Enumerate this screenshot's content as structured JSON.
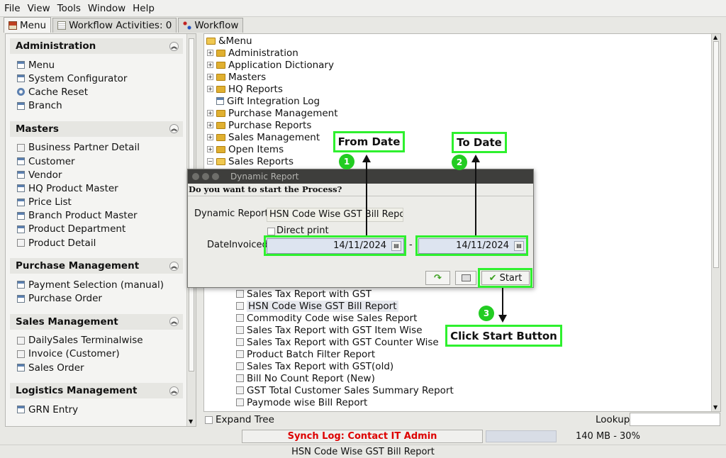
{
  "menubar": {
    "items": [
      "File",
      "View",
      "Tools",
      "Window",
      "Help"
    ]
  },
  "tabs": [
    {
      "label": "Menu"
    },
    {
      "label": "Workflow Activities: 0"
    },
    {
      "label": "Workflow"
    }
  ],
  "sidebar": {
    "groups": [
      {
        "title": "Administration",
        "items": [
          "Menu",
          "System Configurator",
          "Cache Reset",
          "Branch"
        ]
      },
      {
        "title": "Masters",
        "items": [
          "Business Partner Detail",
          "Customer",
          "Vendor",
          "HQ Product Master",
          "Price List",
          "Branch Product Master",
          "Product Department",
          "Product Detail"
        ]
      },
      {
        "title": "Purchase Management",
        "items": [
          "Payment Selection (manual)",
          "Purchase Order"
        ]
      },
      {
        "title": "Sales Management",
        "items": [
          "DailySales Terminalwise",
          "Invoice (Customer)",
          "Sales Order"
        ]
      },
      {
        "title": "Logistics Management",
        "items": [
          "GRN Entry"
        ]
      }
    ]
  },
  "tree": {
    "root": "&Menu",
    "folders": [
      "Administration",
      "Application Dictionary",
      "Masters",
      "HQ Reports",
      "Gift Integration Log",
      "Purchase Management",
      "Purchase Reports",
      "Sales Management",
      "Open Items",
      "Sales Reports"
    ],
    "reports": [
      "Sales Tax Report with GST",
      "HSN Code Wise GST Bill Report",
      "Commodity Code wise Sales Report",
      "Sales Tax Report with GST Item Wise",
      "Sales Tax Report with GST Counter Wise",
      "Product Batch Filter Report",
      "Sales Tax Report with GST(old)",
      "Bill No Count Report (New)",
      "GST Total Customer Sales Summary Report",
      "Paymode wise Bill Report"
    ]
  },
  "bottom": {
    "expand_tree": "Expand Tree",
    "lookup": "Lookup"
  },
  "status": {
    "synch": "Synch Log: Contact IT Admin",
    "memory": "140 MB - 30%",
    "footer": "HSN Code Wise GST Bill Report"
  },
  "dialog": {
    "title": "Dynamic Report",
    "question": "Do you want to start the Process?",
    "report_label": "Dynamic Report",
    "report_value": "HSN Code Wise GST Bill Repor",
    "direct_print": "Direct print",
    "date_label": "DateInvoiced",
    "date_from": "14/11/2024",
    "date_sep": "-",
    "date_to": "14/11/2024",
    "start": "Start"
  },
  "annotations": {
    "from_date": "From Date",
    "to_date": "To Date",
    "click_start": "Click Start Button",
    "n1": "1",
    "n2": "2",
    "n3": "3"
  },
  "colors": {
    "highlight": "#2ef02e",
    "synch_text": "#dd0000",
    "dialog_title_bg": "#3e3e3c"
  }
}
